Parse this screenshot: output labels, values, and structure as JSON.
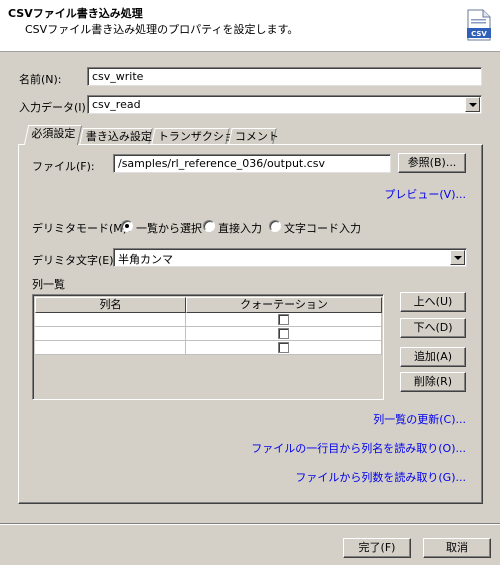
{
  "header": {
    "title": "CSVファイル書き込み処理",
    "description": "CSVファイル書き込み処理のプロパティを設定します。",
    "icon_text": "CSV",
    "icon": "csv-file-icon"
  },
  "form": {
    "name_label": "名前(N):",
    "name_value": "csv_write",
    "input_data_label": "入力データ(I):",
    "input_data_value": "csv_read"
  },
  "tabs": [
    {
      "label": "必須設定",
      "active": true
    },
    {
      "label": "書き込み設定",
      "active": false
    },
    {
      "label": "トランザクション",
      "active": false
    },
    {
      "label": "コメント",
      "active": false
    }
  ],
  "required_tab": {
    "file_label": "ファイル(F):",
    "file_value": "/samples/rl_reference_036/output.csv",
    "browse_button": "参照(B)...",
    "preview_link": "プレビュー(V)...",
    "delimiter_mode_label": "デリミタモード(M):",
    "delimiter_mode_options": [
      {
        "label": "一覧から選択",
        "selected": true
      },
      {
        "label": "直接入力",
        "selected": false
      },
      {
        "label": "文字コード入力",
        "selected": false
      }
    ],
    "delimiter_char_label": "デリミタ文字(E):",
    "delimiter_char_value": "半角カンマ",
    "column_list_label": "列一覧",
    "table": {
      "headers": [
        "列名",
        "クォーテーション"
      ],
      "rows": [
        {
          "name": "",
          "quoted": false
        },
        {
          "name": "",
          "quoted": false
        },
        {
          "name": "",
          "quoted": false
        }
      ]
    },
    "up_button": "上へ(U)",
    "down_button": "下へ(D)",
    "add_button": "追加(A)",
    "delete_button": "削除(R)",
    "links": {
      "refresh": "列一覧の更新(C)...",
      "read_first_line": "ファイルの一行目から列名を読み取り(O)...",
      "read_count": "ファイルから列数を読み取り(G)..."
    }
  },
  "footer": {
    "finish_button": "完了(F)",
    "cancel_button": "取消"
  },
  "colors": {
    "dialog_bg": "#d4d0c8",
    "link": "#0000ee",
    "header_bg": "#ffffff"
  }
}
